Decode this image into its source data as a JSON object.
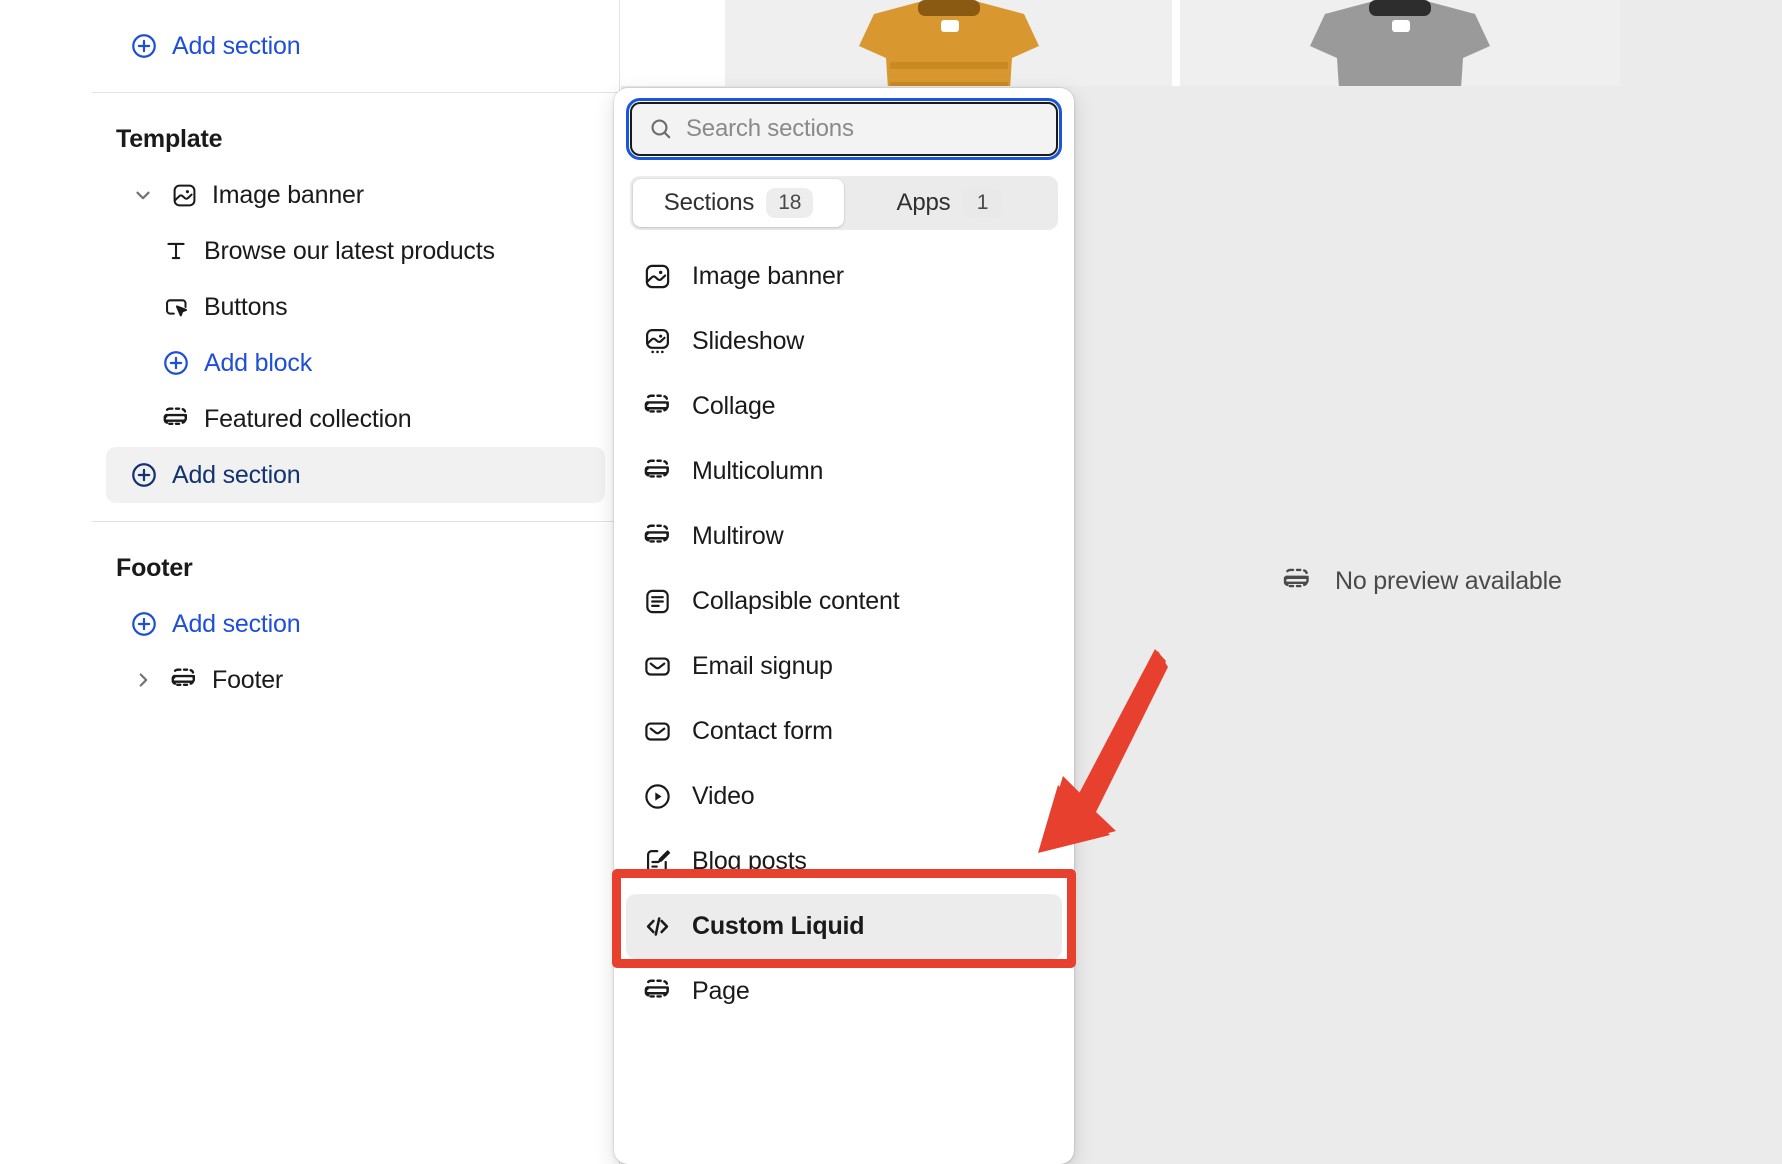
{
  "sidebar": {
    "top_add_section": {
      "label": "Add section",
      "icon": "circle-plus-icon"
    },
    "template_heading": "Template",
    "tree": [
      {
        "label": "Image banner",
        "icon": "image-icon",
        "chevron": "chevron-down-icon",
        "level": 0
      },
      {
        "label": "Browse our latest products",
        "icon": "text-icon",
        "level": 1
      },
      {
        "label": "Buttons",
        "icon": "button-cursor-icon",
        "level": 1
      },
      {
        "label": "Add block",
        "icon": "circle-plus-icon",
        "level": 1,
        "link": true
      },
      {
        "label": "Featured collection",
        "icon": "section-icon",
        "level": 0
      },
      {
        "label": "Add section",
        "icon": "circle-plus-icon",
        "level": 0,
        "link": true,
        "hovered": true
      }
    ],
    "footer_heading": "Footer",
    "footer_add_section": {
      "label": "Add section",
      "icon": "circle-plus-icon"
    },
    "footer_item": {
      "label": "Footer",
      "icon": "section-icon",
      "chevron": "chevron-right-icon"
    }
  },
  "popover": {
    "search": {
      "placeholder": "Search sections",
      "value": "",
      "icon": "search-icon"
    },
    "tabs": [
      {
        "label": "Sections",
        "count": "18",
        "active": true
      },
      {
        "label": "Apps",
        "count": "1",
        "active": false
      }
    ],
    "sections": [
      {
        "label": "Image banner",
        "icon": "image-icon"
      },
      {
        "label": "Slideshow",
        "icon": "slideshow-icon"
      },
      {
        "label": "Collage",
        "icon": "section-icon"
      },
      {
        "label": "Multicolumn",
        "icon": "section-icon"
      },
      {
        "label": "Multirow",
        "icon": "section-icon"
      },
      {
        "label": "Collapsible content",
        "icon": "list-document-icon"
      },
      {
        "label": "Email signup",
        "icon": "envelope-icon"
      },
      {
        "label": "Contact form",
        "icon": "envelope-icon"
      },
      {
        "label": "Video",
        "icon": "play-circle-icon"
      },
      {
        "label": "Blog posts",
        "icon": "note-edit-icon"
      },
      {
        "label": "Custom Liquid",
        "icon": "code-icon",
        "hovered": true
      },
      {
        "label": "Page",
        "icon": "section-icon"
      }
    ]
  },
  "preview": {
    "no_preview_label": "No preview available",
    "no_preview_icon": "section-icon"
  },
  "colors": {
    "link_blue": "#1f4fd8",
    "focus_blue": "#1a56db",
    "annotation_red": "#e8402f",
    "canvas_gray": "#ebebeb",
    "hover_gray": "#ececec"
  }
}
